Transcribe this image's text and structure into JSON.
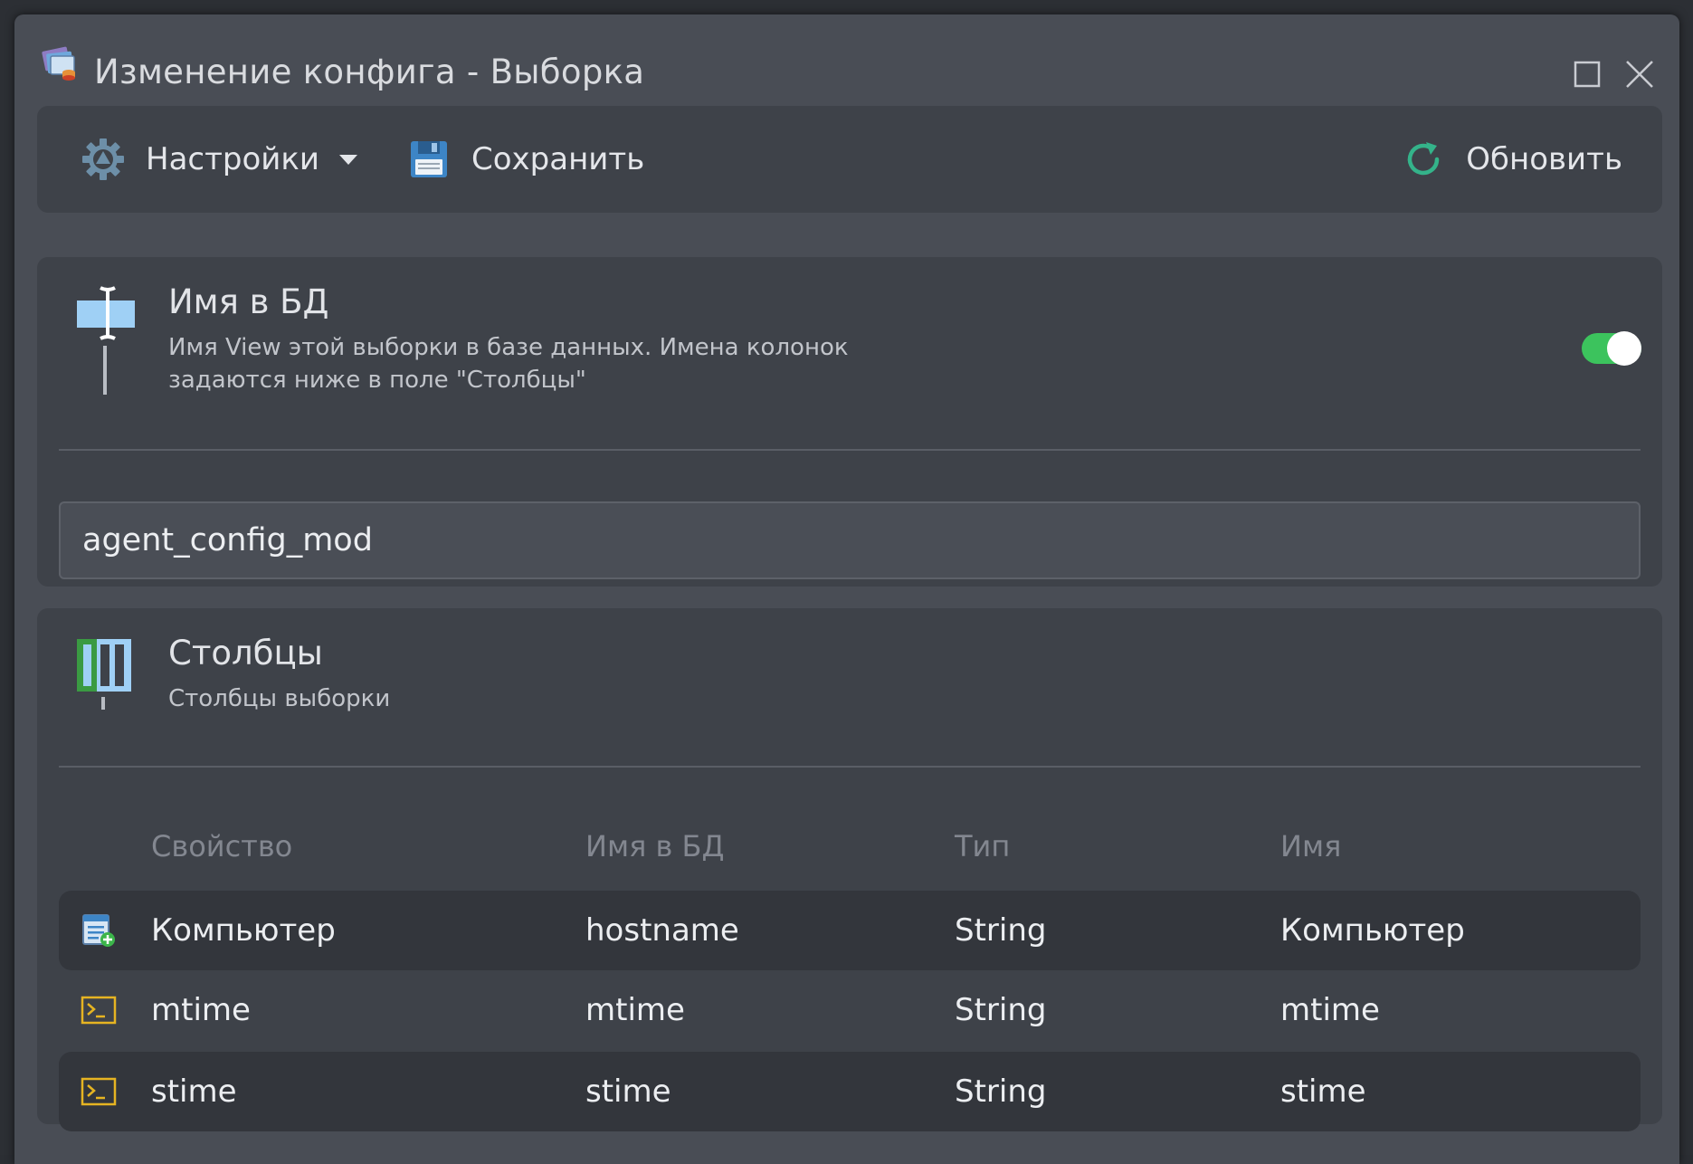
{
  "window": {
    "title": "Изменение конфига - Выборка"
  },
  "toolbar": {
    "settings_label": "Настройки",
    "save_label": "Сохранить",
    "refresh_label": "Обновить"
  },
  "db_name_section": {
    "title": "Имя в БД",
    "description": "Имя View этой выборки в базе данных. Имена колонок задаются ниже в поле \"Столбцы\"",
    "enabled": true,
    "value": "agent_config_mod"
  },
  "columns_section": {
    "title": "Столбцы",
    "description": "Столбцы выборки",
    "headers": [
      "Свойство",
      "Имя в БД",
      "Тип",
      "Имя"
    ],
    "rows": [
      {
        "icon": "add-property-icon",
        "property": "Компьютер",
        "db_name": "hostname",
        "type": "String",
        "name": "Компьютер"
      },
      {
        "icon": "terminal-icon",
        "property": "mtime",
        "db_name": "mtime",
        "type": "String",
        "name": "mtime"
      },
      {
        "icon": "terminal-icon",
        "property": "stime",
        "db_name": "stime",
        "type": "String",
        "name": "stime"
      }
    ]
  },
  "colors": {
    "toggle_on": "#3cc35d",
    "panel_bg": "#3e4249",
    "window_bg": "#494d55",
    "row_highlight": "#33363c"
  }
}
